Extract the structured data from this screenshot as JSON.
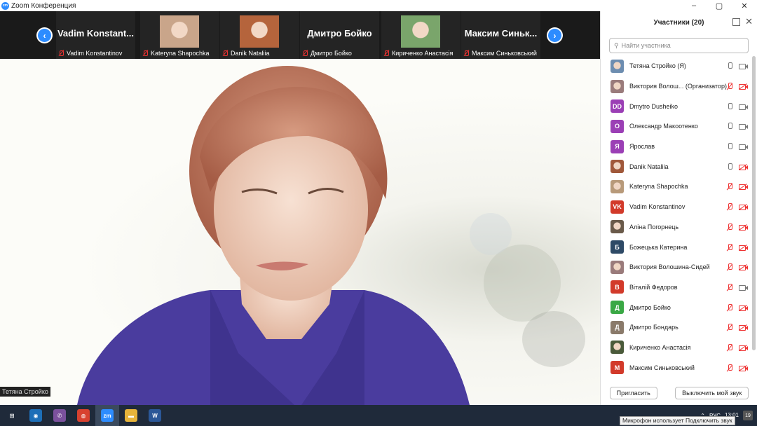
{
  "window": {
    "title": "Zoom Конференция",
    "app_icon": "zm"
  },
  "window_controls": [
    "–",
    "▢",
    "✕"
  ],
  "thumbnails": [
    {
      "big_name": "Vadim  Konstant...",
      "caption": "Vadim Konstantinov",
      "has_photo": false
    },
    {
      "big_name": "",
      "caption": "Kateryna Shapochka",
      "has_photo": true,
      "photo_color": "#c9a58a"
    },
    {
      "big_name": "",
      "caption": "Danik Nataliia",
      "has_photo": true,
      "photo_color": "#b5643c"
    },
    {
      "big_name": "Дмитро Бойко",
      "caption": "Дмитро Бойко",
      "has_photo": false
    },
    {
      "big_name": "",
      "caption": "Кириченко Анастасія",
      "has_photo": true,
      "photo_color": "#7aa56b"
    },
    {
      "big_name": "Максим  Синьк...",
      "caption": "Максим Синьковський",
      "has_photo": false
    }
  ],
  "speaker": {
    "name": "Тетяна Стройко"
  },
  "participants_panel": {
    "title": "Участники (20)",
    "search_placeholder": "Найти участника",
    "participants": [
      {
        "name": "Тетяна Стройко  (Я)",
        "initials": "",
        "avatar_color": "#6d8db0",
        "mic": "on",
        "cam": "on"
      },
      {
        "name": "Виктория Волош...  (Организатор)",
        "initials": "",
        "avatar_color": "#9a7b7b",
        "mic": "muted",
        "cam": "off"
      },
      {
        "name": "Dmytro Dusheiko",
        "initials": "DD",
        "avatar_color": "#9b3fb5",
        "mic": "on",
        "cam": "on"
      },
      {
        "name": "Олександр Макоотенко",
        "initials": "О",
        "avatar_color": "#9b3fb5",
        "mic": "on",
        "cam": "on"
      },
      {
        "name": "Ярослав",
        "initials": "Я",
        "avatar_color": "#9b3fb5",
        "mic": "on",
        "cam": "on"
      },
      {
        "name": "Danik Nataliia",
        "initials": "",
        "avatar_color": "#a0583a",
        "mic": "on",
        "cam": "off"
      },
      {
        "name": "Kateryna Shapochka",
        "initials": "",
        "avatar_color": "#b89a7a",
        "mic": "muted",
        "cam": "off"
      },
      {
        "name": "Vadim Konstantinov",
        "initials": "VK",
        "avatar_color": "#d23a2a",
        "mic": "muted",
        "cam": "off"
      },
      {
        "name": "Аліна Погорнець",
        "initials": "",
        "avatar_color": "#6a5a4a",
        "mic": "muted",
        "cam": "off"
      },
      {
        "name": "Божецька Катерина",
        "initials": "Б",
        "avatar_color": "#2e4a66",
        "mic": "muted",
        "cam": "off"
      },
      {
        "name": "Виктория Волошина-Сидей",
        "initials": "",
        "avatar_color": "#9a7b7b",
        "mic": "muted",
        "cam": "off"
      },
      {
        "name": "Віталій Федоров",
        "initials": "В",
        "avatar_color": "#d23a2a",
        "mic": "muted",
        "cam": "on"
      },
      {
        "name": "Дмитро Бойко",
        "initials": "Д",
        "avatar_color": "#3aa845",
        "mic": "muted",
        "cam": "off"
      },
      {
        "name": "Дмитро Бондарь",
        "initials": "Д",
        "avatar_color": "#8a7a6a",
        "mic": "muted",
        "cam": "off"
      },
      {
        "name": "Кириченко Анастасія",
        "initials": "",
        "avatar_color": "#4a5a3a",
        "mic": "muted",
        "cam": "off"
      },
      {
        "name": "Максим Синьковський",
        "initials": "М",
        "avatar_color": "#d23a2a",
        "mic": "muted",
        "cam": "off"
      }
    ],
    "invite_label": "Пригласить",
    "mute_self_label": "Выключить мой звук"
  },
  "taskbar": {
    "apps": [
      {
        "name": "windows-start",
        "label": "⊞",
        "color": "#1f2a3a"
      },
      {
        "name": "app-blue-circle",
        "label": "◉",
        "color": "#1d6fb8"
      },
      {
        "name": "viber",
        "label": "✆",
        "color": "#7b519d"
      },
      {
        "name": "chrome",
        "label": "◍",
        "color": "#d8412f"
      },
      {
        "name": "zoom",
        "label": "zm",
        "color": "#2d8cff"
      },
      {
        "name": "file-explorer",
        "label": "▬",
        "color": "#e7b43a"
      },
      {
        "name": "word",
        "label": "W",
        "color": "#2b5797"
      }
    ],
    "tray_lang": "РУС",
    "time": "13:01",
    "notifications": "19"
  },
  "tooltip": {
    "text": "Микрофон использует Подключить звук"
  }
}
